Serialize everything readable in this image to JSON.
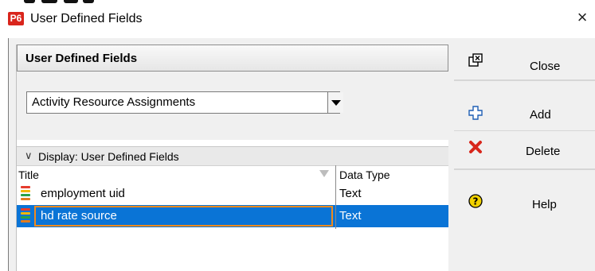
{
  "window": {
    "logo_text": "P6",
    "title": "User Defined Fields",
    "close_glyph": "×"
  },
  "panel": {
    "title": "User Defined Fields",
    "category_select": {
      "value": "Activity Resource Assignments"
    },
    "display_label": "Display: User Defined Fields",
    "display_chevron": "∨"
  },
  "table": {
    "columns": [
      "Title",
      "Data Type"
    ],
    "rows": [
      {
        "title": "employment uid",
        "data_type": "Text",
        "selected": false
      },
      {
        "title": "hd rate source",
        "data_type": "Text",
        "selected": true
      }
    ]
  },
  "buttons": {
    "close": "Close",
    "add": "Add",
    "delete": "Delete",
    "help": "Help"
  },
  "icons": {
    "app": "p6-logo-icon",
    "close_button": "close-window-icon",
    "add": "add-plus-icon",
    "delete": "delete-x-icon",
    "help": "help-question-icon",
    "udf": "udf-field-icon",
    "sort": "sort-descending-icon"
  },
  "colors": {
    "selection": "#0a74d6",
    "edit_outline": "#f08a1c",
    "logo": "#d9251c",
    "delete": "#d8261b",
    "help": "#f2d200"
  }
}
